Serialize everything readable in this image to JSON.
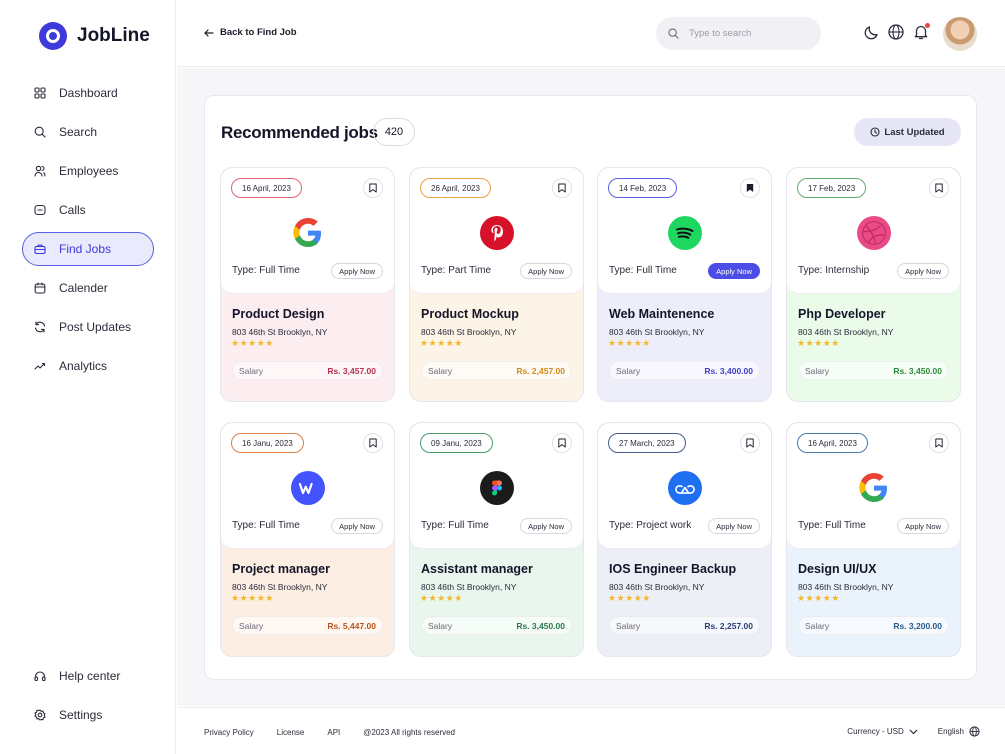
{
  "brand": {
    "name": "JobLine",
    "color": "#3d3ad9"
  },
  "sidebar": {
    "items": [
      {
        "label": "Dashboard",
        "icon": "grid-icon"
      },
      {
        "label": "Search",
        "icon": "search-icon"
      },
      {
        "label": "Employees",
        "icon": "users-icon"
      },
      {
        "label": "Calls",
        "icon": "message-icon"
      },
      {
        "label": "Find Jobs",
        "icon": "briefcase-icon",
        "active": true
      },
      {
        "label": "Calender",
        "icon": "calendar-icon"
      },
      {
        "label": "Post Updates",
        "icon": "refresh-icon"
      },
      {
        "label": "Analytics",
        "icon": "analytics-icon"
      }
    ],
    "bottom": [
      {
        "label": "Help center",
        "icon": "headphones-icon"
      },
      {
        "label": "Settings",
        "icon": "settings-icon"
      }
    ]
  },
  "header": {
    "back_label": "Back to Find Job",
    "search_placeholder": "Type to search"
  },
  "main": {
    "title": "Recommended jobs",
    "count": "420",
    "last_updated_label": "Last Updated"
  },
  "jobs": [
    {
      "date": "16 April, 2023",
      "company_logo": "google-logo",
      "type": "Type:  Full Time",
      "apply": "Apply Now",
      "title": "Product Design",
      "address": "803 46th St Brooklyn, NY",
      "rating": "★★★★★",
      "salary_label": "Salary",
      "salary": "Rs. 3,457.00",
      "bg": "#fcedf0",
      "accent": "#b8314f",
      "date_border": "#e06478",
      "bookmarked": false,
      "primary": false
    },
    {
      "date": "26 April, 2023",
      "company_logo": "pinterest-logo",
      "type": "Type:  Part Time",
      "apply": "Apply Now",
      "title": "Product Mockup",
      "address": "803 46th St Brooklyn, NY",
      "rating": "★★★★★",
      "salary_label": "Salary",
      "salary": "Rs. 2,457.00",
      "bg": "#fdf4e8",
      "accent": "#d48a1a",
      "date_border": "#e2a34a",
      "bookmarked": false,
      "primary": false
    },
    {
      "date": "14 Feb, 2023",
      "company_logo": "spotify-logo",
      "type": "Type:  Full Time",
      "apply": "Apply Now",
      "title": "Web Maintenence",
      "address": "803 46th St Brooklyn, NY",
      "rating": "★★★★★",
      "salary_label": "Salary",
      "salary": "Rs. 3,400.00",
      "bg": "#eeeefb",
      "accent": "#4040cc",
      "date_border": "#5a5ee8",
      "bookmarked": true,
      "primary": true
    },
    {
      "date": "17 Feb, 2023",
      "company_logo": "dribbble-logo",
      "type": "Type:  Internship",
      "apply": "Apply Now",
      "title": "Php Developer",
      "address": "803 46th St Brooklyn, NY",
      "rating": "★★★★★",
      "salary_label": "Salary",
      "salary": "Rs. 3,450.00",
      "bg": "#eafbea",
      "accent": "#2f8a3c",
      "date_border": "#5cb06a",
      "bookmarked": false,
      "primary": false
    },
    {
      "date": "16 Janu, 2023",
      "company_logo": "webflow-logo",
      "type": "Type:  Full Time",
      "apply": "Apply Now",
      "title": "Project manager",
      "address": "803 46th St Brooklyn, NY",
      "rating": "★★★★★",
      "salary_label": "Salary",
      "salary": "Rs. 5,447.00",
      "bg": "#fdeee3",
      "accent": "#b8531f",
      "date_border": "#d8804a",
      "bookmarked": false,
      "primary": false
    },
    {
      "date": "09 Janu, 2023",
      "company_logo": "figma-logo",
      "type": "Type:  Full Time",
      "apply": "Apply Now",
      "title": "Assistant manager",
      "address": "803 46th St Brooklyn, NY",
      "rating": "★★★★★",
      "salary_label": "Salary",
      "salary": "Rs. 3,450.00",
      "bg": "#e8f6ee",
      "accent": "#2a7a4c",
      "date_border": "#4c9a6c",
      "bookmarked": false,
      "primary": false
    },
    {
      "date": "27 March, 2023",
      "company_logo": "cloud-logo",
      "type": "Type:  Project work",
      "apply": "Apply Now",
      "title": "IOS Engineer Backup",
      "address": "803 46th St Brooklyn, NY",
      "rating": "★★★★★",
      "salary_label": "Salary",
      "salary": "Rs. 2,257.00",
      "bg": "#edeff6",
      "accent": "#2b3e7a",
      "date_border": "#4a5a8e",
      "bookmarked": false,
      "primary": false
    },
    {
      "date": "16 April, 2023",
      "company_logo": "google-logo",
      "type": "Type:  Full Time",
      "apply": "Apply Now",
      "title": "Design UI/UX",
      "address": "803 46th St Brooklyn, NY",
      "rating": "★★★★★",
      "salary_label": "Salary",
      "salary": "Rs. 3,200.00",
      "bg": "#eaf2fb",
      "accent": "#2a5a8a",
      "date_border": "#4a7aa8",
      "bookmarked": false,
      "primary": false
    }
  ],
  "footer": {
    "links": [
      "Privacy Policy",
      "License",
      "API",
      "@2023 All rights reserved"
    ],
    "currency": "Currency - USD",
    "language": "English"
  }
}
